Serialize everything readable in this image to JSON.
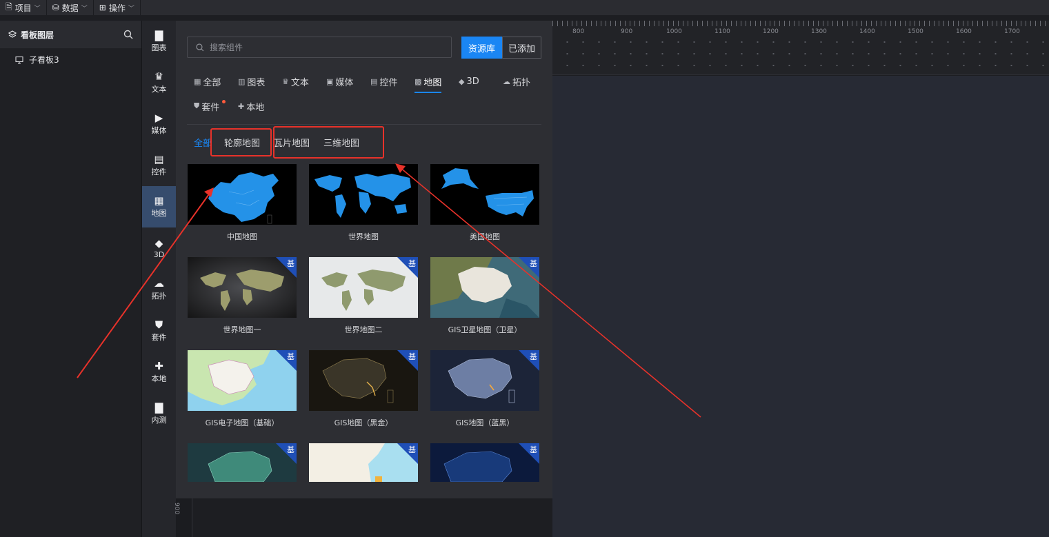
{
  "topbar": {
    "menus": [
      {
        "label": "项目",
        "icon": "file-icon"
      },
      {
        "label": "数据",
        "icon": "database-icon"
      },
      {
        "label": "操作",
        "icon": "grid-icon"
      }
    ]
  },
  "layer_panel": {
    "title": "看板图层",
    "items": [
      {
        "label": "子看板3",
        "icon": "monitor-icon"
      }
    ]
  },
  "category_bar": {
    "items": [
      {
        "label": "图表",
        "icon": "bar-chart-icon"
      },
      {
        "label": "文本",
        "icon": "crown-text-icon"
      },
      {
        "label": "媒体",
        "icon": "media-icon"
      },
      {
        "label": "控件",
        "icon": "widget-icon"
      },
      {
        "label": "地图",
        "icon": "map-icon",
        "active": true
      },
      {
        "label": "3D",
        "icon": "cube-icon"
      },
      {
        "label": "拓扑",
        "icon": "topology-icon"
      },
      {
        "label": "套件",
        "icon": "shirt-icon"
      },
      {
        "label": "本地",
        "icon": "puzzle-icon"
      },
      {
        "label": "内测",
        "icon": "bar-chart-icon"
      }
    ]
  },
  "resource_panel": {
    "search_placeholder": "搜索组件",
    "source_buttons": {
      "library": "资源库",
      "added": "已添加"
    },
    "tabs": [
      {
        "label": "全部",
        "icon": "grid-icon"
      },
      {
        "label": "图表",
        "icon": "bar-chart-icon"
      },
      {
        "label": "文本",
        "icon": "crown-text-icon"
      },
      {
        "label": "媒体",
        "icon": "media-icon"
      },
      {
        "label": "控件",
        "icon": "widget-icon"
      },
      {
        "label": "地图",
        "icon": "map-icon",
        "active": true
      },
      {
        "label": "3D",
        "icon": "cube-icon"
      },
      {
        "label": "拓扑",
        "icon": "topology-icon"
      },
      {
        "label": "套件",
        "icon": "shirt-icon"
      },
      {
        "label": "本地",
        "icon": "puzzle-icon"
      }
    ],
    "subtabs": [
      {
        "label": "全部",
        "active": true
      },
      {
        "label": "轮廓地图"
      },
      {
        "label": "瓦片地图"
      },
      {
        "label": "三维地图"
      }
    ],
    "badge_text": "基",
    "cards": [
      {
        "label": "中国地图",
        "badge": false
      },
      {
        "label": "世界地图",
        "badge": false
      },
      {
        "label": "美国地图",
        "badge": false
      },
      {
        "label": "世界地图一",
        "badge": true
      },
      {
        "label": "世界地图二",
        "badge": true
      },
      {
        "label": "GIS卫星地图（卫星）",
        "badge": true
      },
      {
        "label": "GIS电子地图（基础）",
        "badge": true
      },
      {
        "label": "GIS地图（黑金）",
        "badge": true
      },
      {
        "label": "GIS地图（蓝黑）",
        "badge": true
      },
      {
        "label": "",
        "badge": true
      },
      {
        "label": "",
        "badge": true
      },
      {
        "label": "",
        "badge": true
      }
    ]
  },
  "ruler": {
    "labels": [
      "800",
      "900",
      "1000",
      "1100",
      "1200",
      "1300",
      "1400",
      "1500",
      "1600",
      "1700"
    ],
    "vertical_label": "900"
  },
  "colors": {
    "accent": "#1a86f4",
    "annotation": "#e8322a",
    "panel": "#2d2e33"
  }
}
